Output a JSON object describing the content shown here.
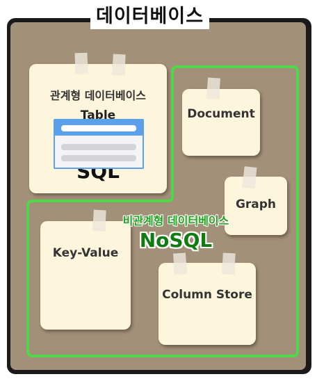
{
  "title": "데이터베이스",
  "relational": {
    "label": "관계형 데이터베이스",
    "table_label": "Table",
    "sql_label": "SQL"
  },
  "nonrelational": {
    "label": "비관계형 데이터베이스",
    "nosql_label": "NoSQL"
  },
  "cards": {
    "document": "Document",
    "graph": "Graph",
    "key_value": "Key-Value",
    "column_store": "Column Store"
  },
  "colors": {
    "board_border": "#1a1a1a",
    "board_fill": "#a39078",
    "card_fill": "#fdf6dc",
    "nosql_outline": "#44e044",
    "nosql_text": "#117a11",
    "table_accent": "#5aa0ea"
  }
}
